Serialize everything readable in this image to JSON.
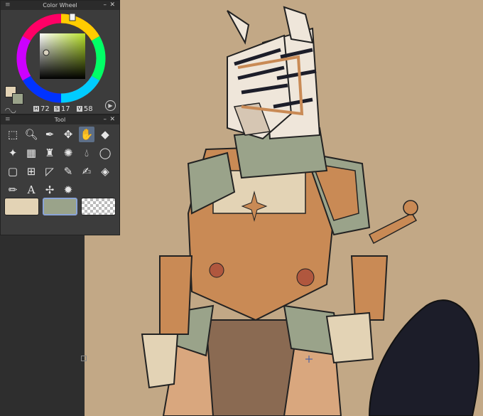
{
  "color_wheel": {
    "title": "Color Wheel",
    "h_label": "H",
    "h_value": "72",
    "s_label": "S",
    "s_value": "17",
    "v_label": "V",
    "v_value": "58",
    "primary_color": "#e3d3b5",
    "secondary_color": "#9aa38a"
  },
  "tool_panel": {
    "title": "Tool",
    "tools": [
      "select-layer",
      "zoom",
      "eyedropper",
      "move",
      "hand",
      "eraser",
      "sparkle",
      "gradient",
      "fill-bucket",
      "burst",
      "blur",
      "lasso",
      "rect-select",
      "transform",
      "ruler",
      "pen",
      "brush",
      "fill",
      "pencil",
      "text",
      "color-mixing",
      "decoration"
    ],
    "active_tool": "hand",
    "swatches": [
      "#e3d3b5",
      "#9aa38a",
      "transparent"
    ]
  }
}
